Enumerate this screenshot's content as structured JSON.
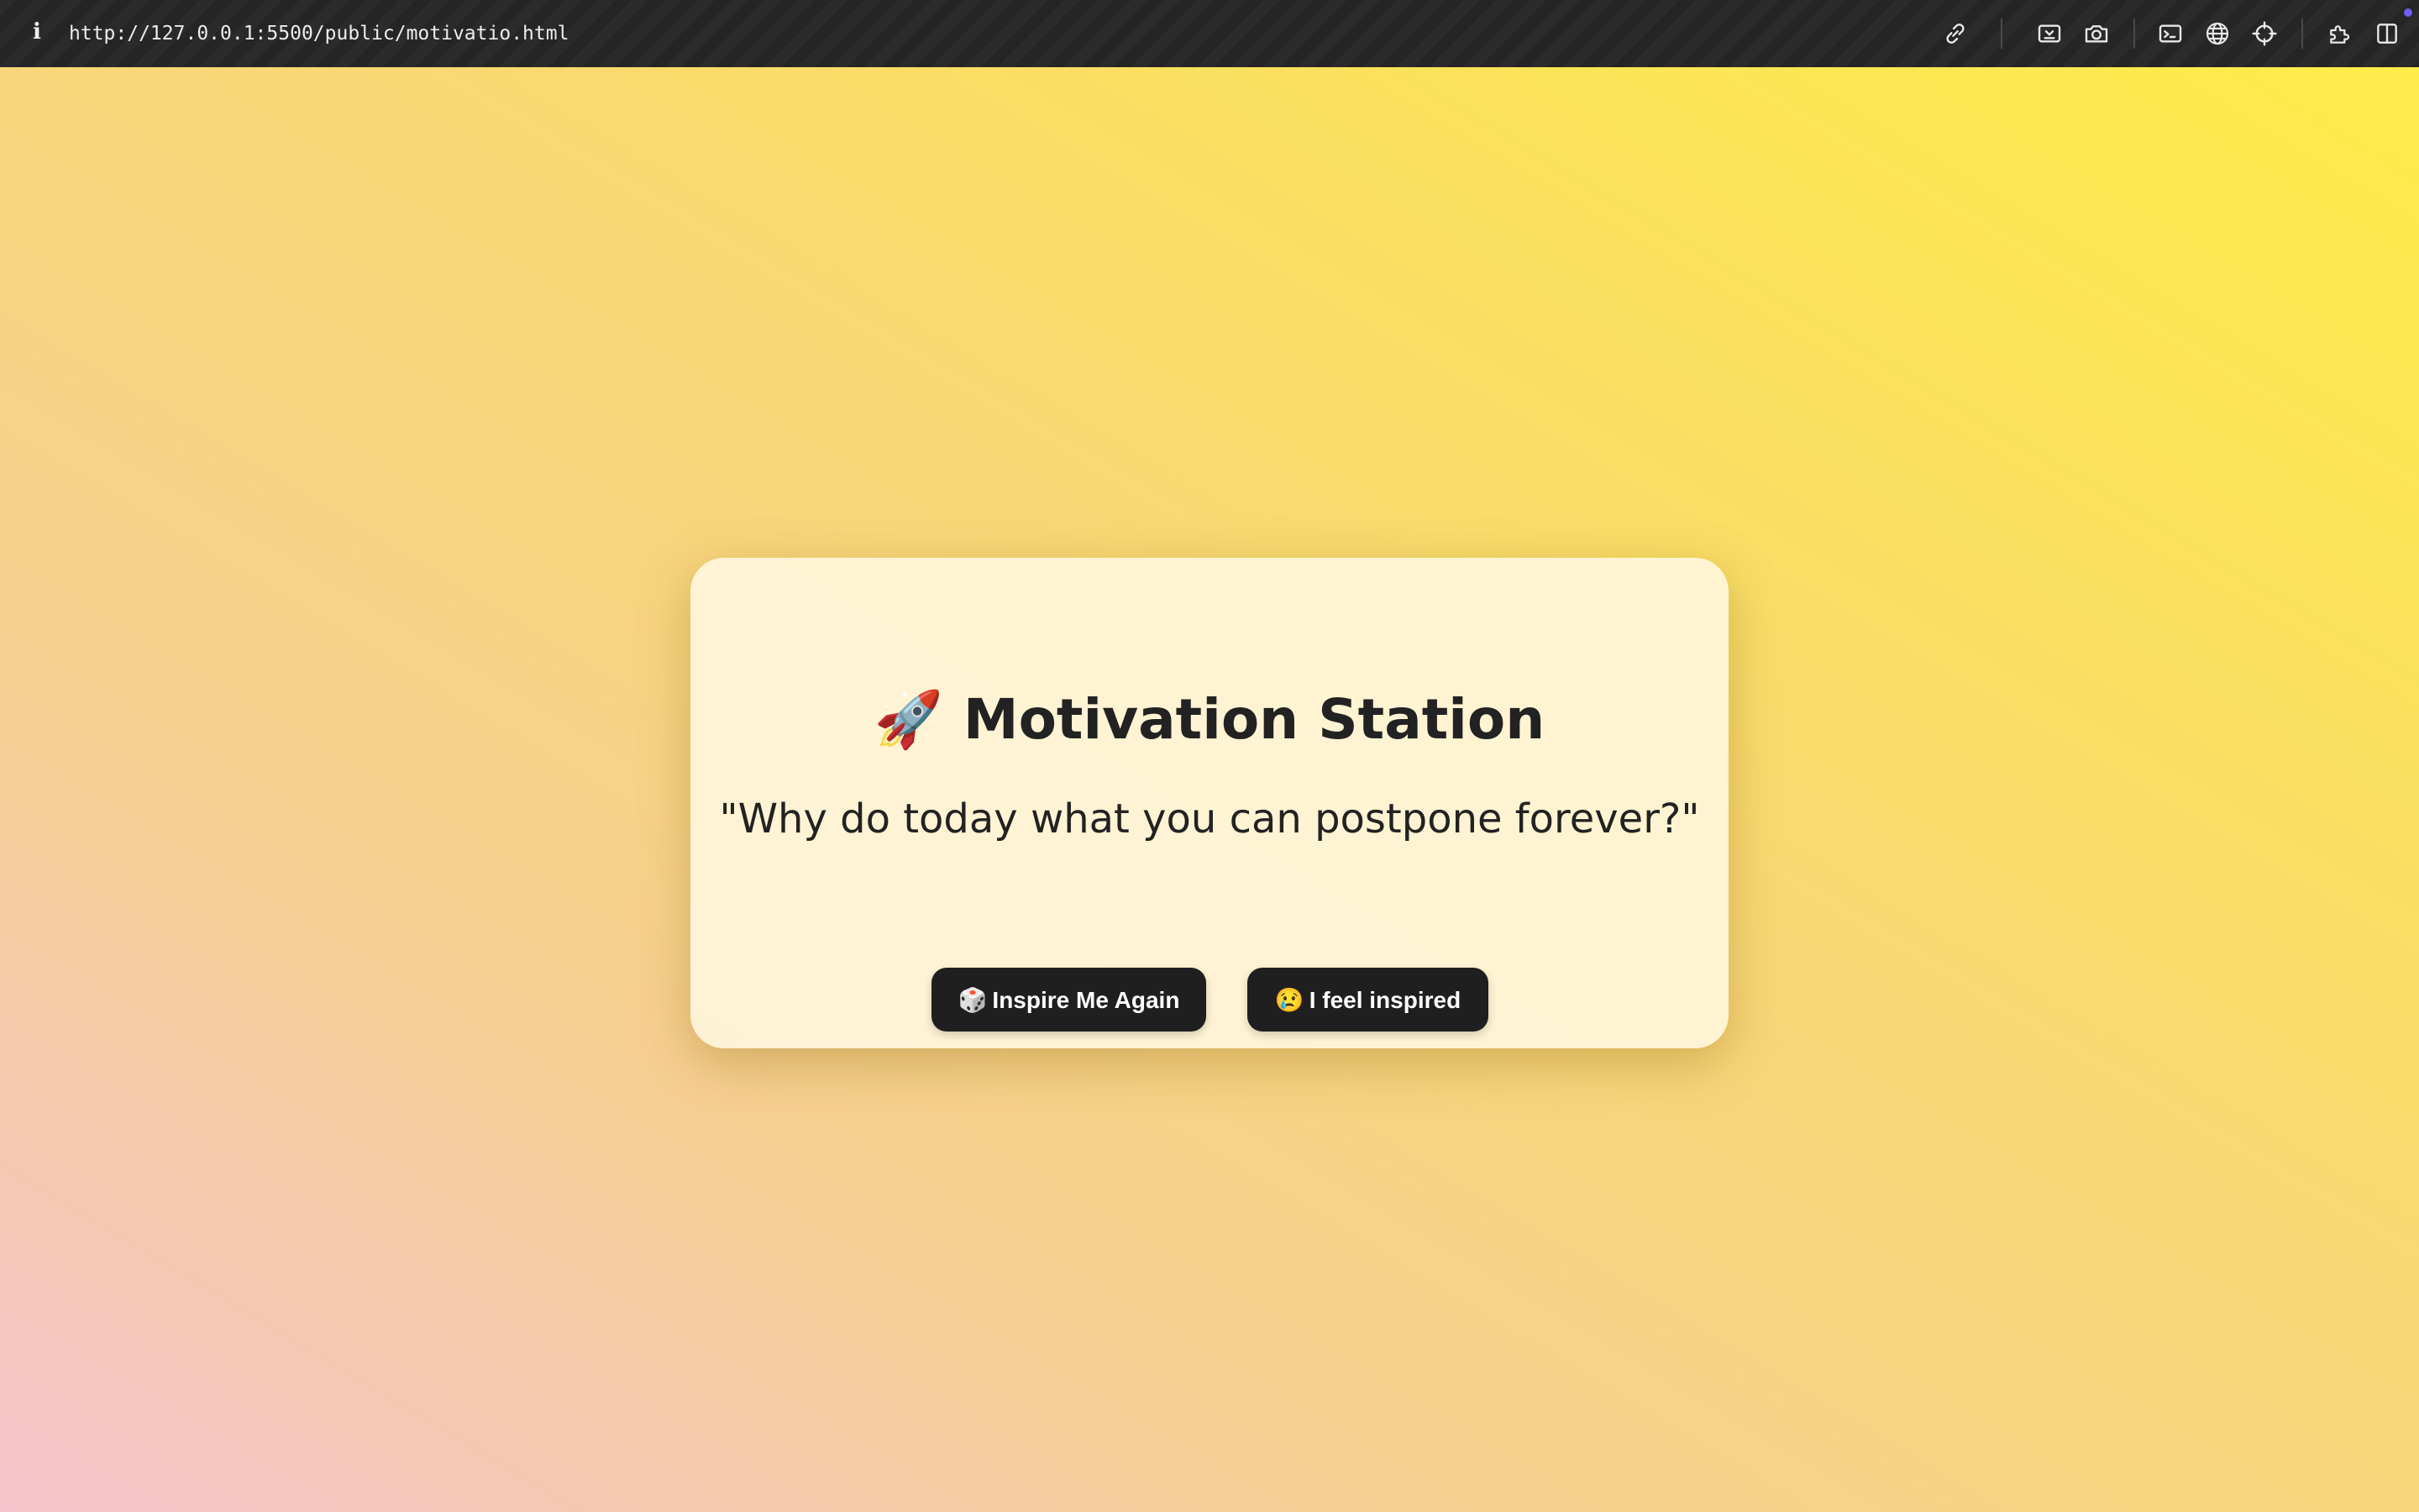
{
  "browser": {
    "info_icon": "i",
    "url": "http://127.0.0.1:5500/public/motivatio.html",
    "toolbar_icons": [
      "link-icon",
      "screenshot-icon",
      "camera-icon",
      "terminal-icon",
      "globe-icon",
      "crosshair-icon",
      "extensions-icon",
      "split-view-icon"
    ]
  },
  "card": {
    "title_emoji": "🚀",
    "title": "Motivation Station",
    "quote": "\"Why do today what you can postpone forever?\""
  },
  "buttons": {
    "inspire_emoji": "🎲",
    "inspire_label": "Inspire Me Again",
    "feel_emoji": "😢",
    "feel_label": "I feel inspired"
  },
  "colors": {
    "toolbar": "#2b2b2b",
    "background_from": "#f6c4cc",
    "background_to": "#fdec4a",
    "card": "#fff6e0",
    "button": "#1f1f1f",
    "button_text": "#ffffff",
    "text": "#222222"
  }
}
